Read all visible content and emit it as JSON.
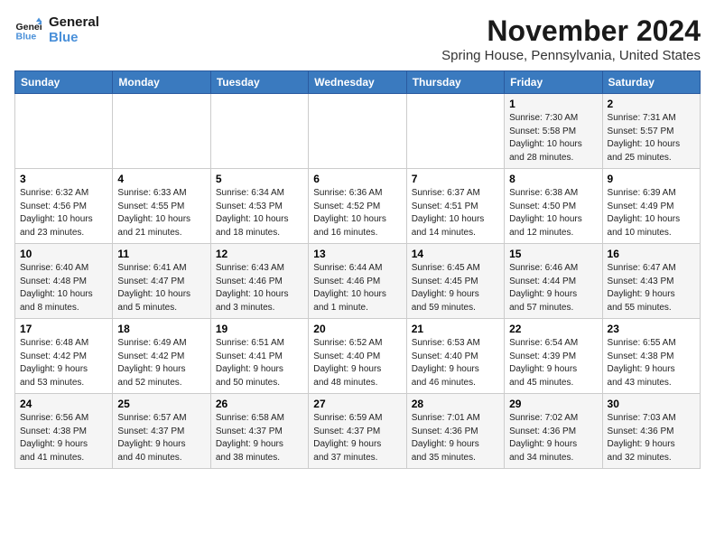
{
  "logo": {
    "line1": "General",
    "line2": "Blue"
  },
  "title": "November 2024",
  "location": "Spring House, Pennsylvania, United States",
  "days_of_week": [
    "Sunday",
    "Monday",
    "Tuesday",
    "Wednesday",
    "Thursday",
    "Friday",
    "Saturday"
  ],
  "weeks": [
    [
      {
        "day": "",
        "info": ""
      },
      {
        "day": "",
        "info": ""
      },
      {
        "day": "",
        "info": ""
      },
      {
        "day": "",
        "info": ""
      },
      {
        "day": "",
        "info": ""
      },
      {
        "day": "1",
        "info": "Sunrise: 7:30 AM\nSunset: 5:58 PM\nDaylight: 10 hours\nand 28 minutes."
      },
      {
        "day": "2",
        "info": "Sunrise: 7:31 AM\nSunset: 5:57 PM\nDaylight: 10 hours\nand 25 minutes."
      }
    ],
    [
      {
        "day": "3",
        "info": "Sunrise: 6:32 AM\nSunset: 4:56 PM\nDaylight: 10 hours\nand 23 minutes."
      },
      {
        "day": "4",
        "info": "Sunrise: 6:33 AM\nSunset: 4:55 PM\nDaylight: 10 hours\nand 21 minutes."
      },
      {
        "day": "5",
        "info": "Sunrise: 6:34 AM\nSunset: 4:53 PM\nDaylight: 10 hours\nand 18 minutes."
      },
      {
        "day": "6",
        "info": "Sunrise: 6:36 AM\nSunset: 4:52 PM\nDaylight: 10 hours\nand 16 minutes."
      },
      {
        "day": "7",
        "info": "Sunrise: 6:37 AM\nSunset: 4:51 PM\nDaylight: 10 hours\nand 14 minutes."
      },
      {
        "day": "8",
        "info": "Sunrise: 6:38 AM\nSunset: 4:50 PM\nDaylight: 10 hours\nand 12 minutes."
      },
      {
        "day": "9",
        "info": "Sunrise: 6:39 AM\nSunset: 4:49 PM\nDaylight: 10 hours\nand 10 minutes."
      }
    ],
    [
      {
        "day": "10",
        "info": "Sunrise: 6:40 AM\nSunset: 4:48 PM\nDaylight: 10 hours\nand 8 minutes."
      },
      {
        "day": "11",
        "info": "Sunrise: 6:41 AM\nSunset: 4:47 PM\nDaylight: 10 hours\nand 5 minutes."
      },
      {
        "day": "12",
        "info": "Sunrise: 6:43 AM\nSunset: 4:46 PM\nDaylight: 10 hours\nand 3 minutes."
      },
      {
        "day": "13",
        "info": "Sunrise: 6:44 AM\nSunset: 4:46 PM\nDaylight: 10 hours\nand 1 minute."
      },
      {
        "day": "14",
        "info": "Sunrise: 6:45 AM\nSunset: 4:45 PM\nDaylight: 9 hours\nand 59 minutes."
      },
      {
        "day": "15",
        "info": "Sunrise: 6:46 AM\nSunset: 4:44 PM\nDaylight: 9 hours\nand 57 minutes."
      },
      {
        "day": "16",
        "info": "Sunrise: 6:47 AM\nSunset: 4:43 PM\nDaylight: 9 hours\nand 55 minutes."
      }
    ],
    [
      {
        "day": "17",
        "info": "Sunrise: 6:48 AM\nSunset: 4:42 PM\nDaylight: 9 hours\nand 53 minutes."
      },
      {
        "day": "18",
        "info": "Sunrise: 6:49 AM\nSunset: 4:42 PM\nDaylight: 9 hours\nand 52 minutes."
      },
      {
        "day": "19",
        "info": "Sunrise: 6:51 AM\nSunset: 4:41 PM\nDaylight: 9 hours\nand 50 minutes."
      },
      {
        "day": "20",
        "info": "Sunrise: 6:52 AM\nSunset: 4:40 PM\nDaylight: 9 hours\nand 48 minutes."
      },
      {
        "day": "21",
        "info": "Sunrise: 6:53 AM\nSunset: 4:40 PM\nDaylight: 9 hours\nand 46 minutes."
      },
      {
        "day": "22",
        "info": "Sunrise: 6:54 AM\nSunset: 4:39 PM\nDaylight: 9 hours\nand 45 minutes."
      },
      {
        "day": "23",
        "info": "Sunrise: 6:55 AM\nSunset: 4:38 PM\nDaylight: 9 hours\nand 43 minutes."
      }
    ],
    [
      {
        "day": "24",
        "info": "Sunrise: 6:56 AM\nSunset: 4:38 PM\nDaylight: 9 hours\nand 41 minutes."
      },
      {
        "day": "25",
        "info": "Sunrise: 6:57 AM\nSunset: 4:37 PM\nDaylight: 9 hours\nand 40 minutes."
      },
      {
        "day": "26",
        "info": "Sunrise: 6:58 AM\nSunset: 4:37 PM\nDaylight: 9 hours\nand 38 minutes."
      },
      {
        "day": "27",
        "info": "Sunrise: 6:59 AM\nSunset: 4:37 PM\nDaylight: 9 hours\nand 37 minutes."
      },
      {
        "day": "28",
        "info": "Sunrise: 7:01 AM\nSunset: 4:36 PM\nDaylight: 9 hours\nand 35 minutes."
      },
      {
        "day": "29",
        "info": "Sunrise: 7:02 AM\nSunset: 4:36 PM\nDaylight: 9 hours\nand 34 minutes."
      },
      {
        "day": "30",
        "info": "Sunrise: 7:03 AM\nSunset: 4:36 PM\nDaylight: 9 hours\nand 32 minutes."
      }
    ]
  ]
}
